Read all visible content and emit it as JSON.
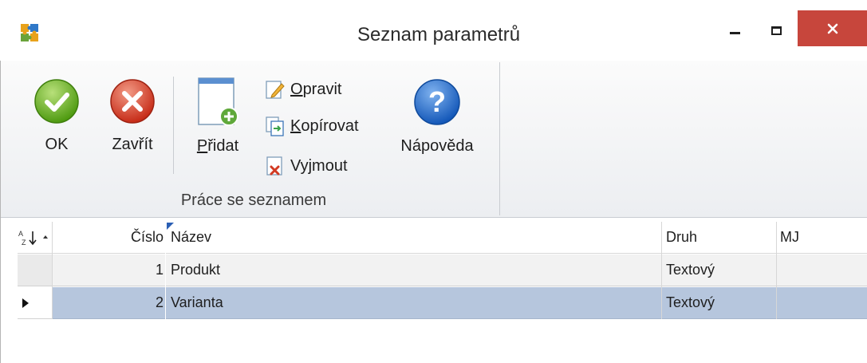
{
  "window": {
    "title": "Seznam parametrů",
    "app_icon": "app-puzzle-icon",
    "minimize_icon": "minimize-icon",
    "maximize_icon": "maximize-icon",
    "close_icon": "close-icon",
    "close_color": "#c7463c"
  },
  "ribbon": {
    "ok": {
      "label": "OK",
      "icon": "check-circle-icon"
    },
    "close": {
      "label": "Zavřít",
      "icon": "x-circle-icon"
    },
    "add": {
      "label_accel": "P",
      "label_rest": "řidat",
      "icon": "new-document-icon"
    },
    "edit": {
      "label_accel": "O",
      "label_rest": "pravit",
      "icon": "edit-icon"
    },
    "copy": {
      "label_accel": "K",
      "label_rest": "opírovat",
      "icon": "copy-icon"
    },
    "remove": {
      "label": "Vyjmout",
      "icon": "cut-icon"
    },
    "help": {
      "label": "Nápověda",
      "icon": "help-circle-icon"
    },
    "group_label": "Práce se seznamem"
  },
  "grid": {
    "columns": {
      "sort_icon": "sort-az-icon",
      "number": "Číslo",
      "name": "Název",
      "type": "Druh",
      "unit": "MJ"
    },
    "rows": [
      {
        "number": "1",
        "name": "Produkt",
        "type": "Textový",
        "unit": "",
        "selected": false
      },
      {
        "number": "2",
        "name": "Varianta",
        "type": "Textový",
        "unit": "",
        "selected": true
      }
    ],
    "selected_row_color": "#b6c6dd",
    "row_indicator_icon": "row-pointer-icon"
  }
}
